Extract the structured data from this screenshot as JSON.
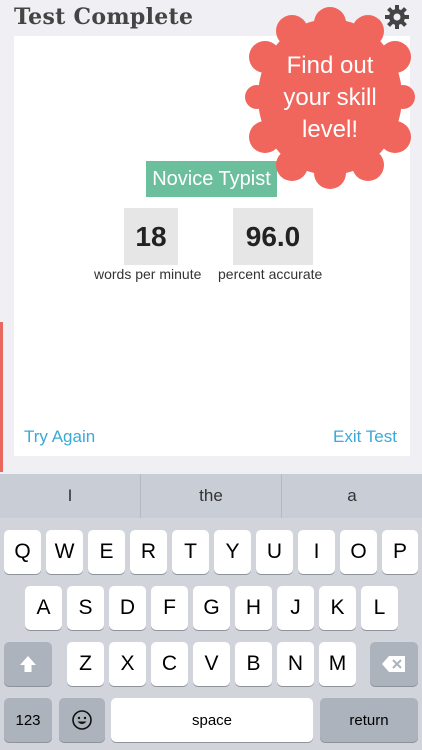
{
  "header": {
    "title": "Test Complete",
    "settings_icon": "gear-icon"
  },
  "result": {
    "level": "Novice Typist",
    "wpm_value": "18",
    "wpm_label": "words per minute",
    "accuracy_value": "96.0",
    "accuracy_label": "percent accurate",
    "try_again": "Try Again",
    "exit_test": "Exit Test"
  },
  "callout": {
    "line1": "Find out",
    "line2": "your skill",
    "line3": "level!"
  },
  "keyboard": {
    "suggestions": [
      "I",
      "the",
      "a"
    ],
    "row1": [
      "Q",
      "W",
      "E",
      "R",
      "T",
      "Y",
      "U",
      "I",
      "O",
      "P"
    ],
    "row2": [
      "A",
      "S",
      "D",
      "F",
      "G",
      "H",
      "J",
      "K",
      "L"
    ],
    "row3": [
      "Z",
      "X",
      "C",
      "V",
      "B",
      "N",
      "M"
    ],
    "numbers_label": "123",
    "space_label": "space",
    "return_label": "return",
    "shift_icon": "shift-arrow-icon",
    "delete_icon": "backspace-icon",
    "emoji_icon": "emoji-icon"
  },
  "colors": {
    "badge": "#6cbf9c",
    "callout": "#f0655c",
    "link": "#3aa9d8"
  }
}
